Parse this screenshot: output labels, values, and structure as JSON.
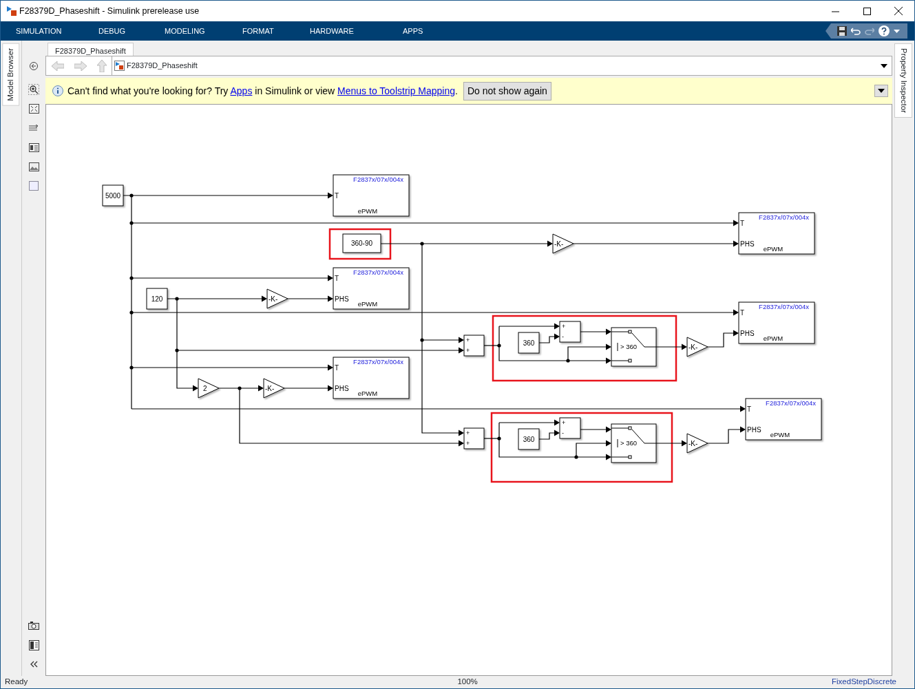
{
  "window": {
    "title": "F28379D_Phaseshift - Simulink prerelease use"
  },
  "toolstrip_tabs": [
    {
      "label": "SIMULATION"
    },
    {
      "label": "DEBUG"
    },
    {
      "label": "MODELING"
    },
    {
      "label": "FORMAT"
    },
    {
      "label": "HARDWARE"
    },
    {
      "label": "APPS"
    }
  ],
  "left_panel": {
    "label": "Model Browser"
  },
  "right_panel": {
    "label": "Property Inspector"
  },
  "editor_tab": {
    "label": "F28379D_Phaseshift"
  },
  "address_bar": {
    "path": "F28379D_Phaseshift"
  },
  "banner": {
    "text_1": "Can't find what you're looking for? Try",
    "link_1": "Apps",
    "text_2": "in Simulink or view",
    "link_2": "Menus to Toolstrip Mapping",
    "text_3": ".",
    "button": "Do not show again"
  },
  "diagram": {
    "blocks": [
      {
        "kind": "constant",
        "text": "5000"
      },
      {
        "kind": "epwm",
        "title": "F2837x/07x/004x",
        "ports": [
          "T"
        ],
        "footer": "ePWM"
      },
      {
        "kind": "constant",
        "text": "360-90"
      },
      {
        "kind": "gain",
        "text": "-K-"
      },
      {
        "kind": "epwm",
        "title": "F2837x/07x/004x",
        "ports": [
          "T",
          "PHS"
        ],
        "footer": "ePWM"
      },
      {
        "kind": "constant",
        "text": "120"
      },
      {
        "kind": "gain",
        "text": "-K-"
      },
      {
        "kind": "epwm",
        "title": "F2837x/07x/004x",
        "ports": [
          "T",
          "PHS"
        ],
        "footer": "ePWM"
      },
      {
        "kind": "epwm",
        "title": "F2837x/07x/004x",
        "ports": [
          "T",
          "PHS"
        ],
        "footer": "ePWM"
      },
      {
        "kind": "sum",
        "signs": [
          "+",
          "+"
        ]
      },
      {
        "kind": "constant",
        "text": "360"
      },
      {
        "kind": "sum",
        "signs": [
          "+",
          "-"
        ]
      },
      {
        "kind": "switch",
        "text": "> 360"
      },
      {
        "kind": "gain",
        "text": "-K-"
      },
      {
        "kind": "gain",
        "text": "2"
      },
      {
        "kind": "gain",
        "text": "-K-"
      },
      {
        "kind": "epwm",
        "title": "F2837x/07x/004x",
        "ports": [
          "T",
          "PHS"
        ],
        "footer": "ePWM"
      },
      {
        "kind": "epwm",
        "title": "F2837x/07x/004x",
        "ports": [
          "T",
          "PHS"
        ],
        "footer": "ePWM"
      },
      {
        "kind": "sum",
        "signs": [
          "+",
          "+"
        ]
      },
      {
        "kind": "constant",
        "text": "360"
      },
      {
        "kind": "sum",
        "signs": [
          "+",
          "-"
        ]
      },
      {
        "kind": "switch",
        "text": "> 360"
      },
      {
        "kind": "gain",
        "text": "-K-"
      }
    ]
  },
  "status_bar": {
    "status": "Ready",
    "zoom": "100%",
    "solver": "FixedStepDiscrete"
  }
}
